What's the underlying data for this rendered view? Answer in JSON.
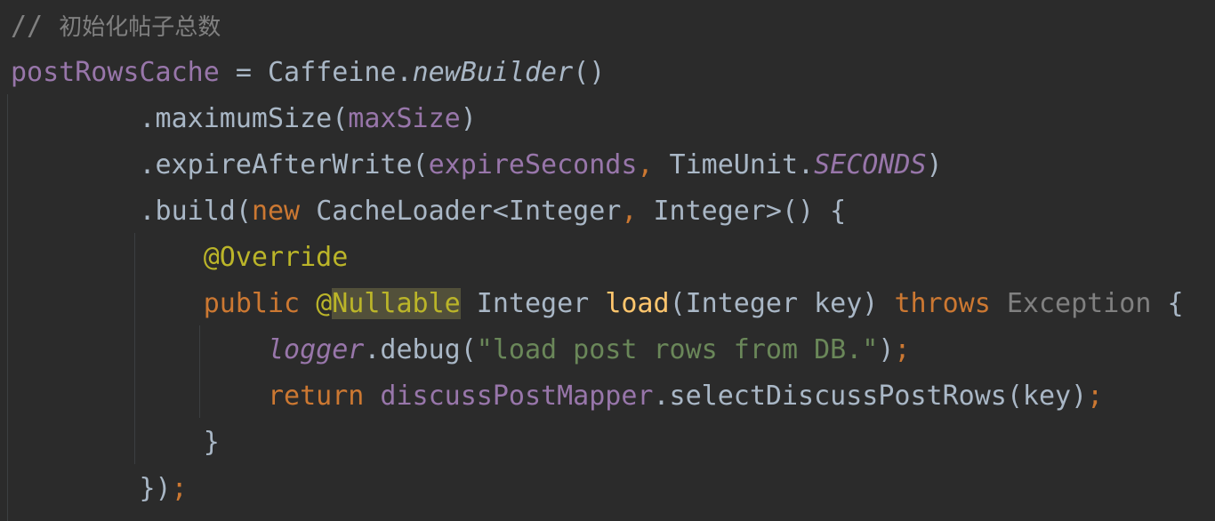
{
  "lines": [
    [
      {
        "t": "// ",
        "c": "t-comment",
        "n": "comment-prefix"
      },
      {
        "t": "初始化帖子总数",
        "c": "t-comment-cn",
        "n": "comment-text"
      }
    ],
    [
      {
        "t": "postRowsCache",
        "c": "t-field",
        "n": "field-postRowsCache"
      },
      {
        "t": " = Caffeine.",
        "c": "t-plain",
        "n": "assign-caffeine"
      },
      {
        "t": "newBuilder",
        "c": "t-method-i",
        "n": "method-newBuilder"
      },
      {
        "t": "()",
        "c": "t-plain",
        "n": "parens"
      }
    ],
    [
      {
        "t": "        .maximumSize(",
        "c": "t-plain",
        "n": "method-maximumSize"
      },
      {
        "t": "maxSize",
        "c": "t-field",
        "n": "field-maxSize"
      },
      {
        "t": ")",
        "c": "t-plain",
        "n": "paren-close"
      }
    ],
    [
      {
        "t": "        .expireAfterWrite(",
        "c": "t-plain",
        "n": "method-expireAfterWrite"
      },
      {
        "t": "expireSeconds",
        "c": "t-field",
        "n": "field-expireSeconds"
      },
      {
        "t": ", ",
        "c": "t-kw",
        "n": "comma"
      },
      {
        "t": "TimeUnit.",
        "c": "t-plain",
        "n": "class-TimeUnit"
      },
      {
        "t": "SECONDS",
        "c": "t-field-i",
        "n": "const-SECONDS"
      },
      {
        "t": ")",
        "c": "t-plain",
        "n": "paren-close"
      }
    ],
    [
      {
        "t": "        .build(",
        "c": "t-plain",
        "n": "method-build"
      },
      {
        "t": "new ",
        "c": "t-kw",
        "n": "keyword-new"
      },
      {
        "t": "CacheLoader<Integer",
        "c": "t-plain",
        "n": "type-CacheLoader"
      },
      {
        "t": ", ",
        "c": "t-kw",
        "n": "comma"
      },
      {
        "t": "Integer>() {",
        "c": "t-plain",
        "n": "type-Integer-brace"
      }
    ],
    [
      {
        "t": "            ",
        "c": "t-plain",
        "n": "indent"
      },
      {
        "t": "@Override",
        "c": "t-anno",
        "n": "annotation-override"
      }
    ],
    [
      {
        "t": "            ",
        "c": "t-plain",
        "n": "indent"
      },
      {
        "t": "public ",
        "c": "t-kw",
        "n": "keyword-public"
      },
      {
        "t": "@",
        "c": "t-anno",
        "n": "annotation-at"
      },
      {
        "t": "Nullable",
        "c": "t-anno t-hl",
        "n": "annotation-nullable"
      },
      {
        "t": " Integer ",
        "c": "t-plain",
        "n": "type-Integer"
      },
      {
        "t": "load",
        "c": "t-decl",
        "n": "method-load"
      },
      {
        "t": "(Integer key) ",
        "c": "t-plain",
        "n": "params"
      },
      {
        "t": "throws ",
        "c": "t-kw",
        "n": "keyword-throws"
      },
      {
        "t": "Exception",
        "c": "t-unused",
        "n": "type-Exception"
      },
      {
        "t": " {",
        "c": "t-plain",
        "n": "brace-open"
      }
    ],
    [
      {
        "t": "                ",
        "c": "t-plain",
        "n": "indent"
      },
      {
        "t": "logger",
        "c": "t-field-i",
        "n": "field-logger"
      },
      {
        "t": ".debug(",
        "c": "t-plain",
        "n": "method-debug"
      },
      {
        "t": "\"load post rows from DB.\"",
        "c": "t-string",
        "n": "string-literal"
      },
      {
        "t": ")",
        "c": "t-plain",
        "n": "paren-close"
      },
      {
        "t": ";",
        "c": "t-kw",
        "n": "semicolon"
      }
    ],
    [
      {
        "t": "                ",
        "c": "t-plain",
        "n": "indent"
      },
      {
        "t": "return ",
        "c": "t-kw",
        "n": "keyword-return"
      },
      {
        "t": "discussPostMapper",
        "c": "t-field",
        "n": "field-discussPostMapper"
      },
      {
        "t": ".selectDiscussPostRows(key)",
        "c": "t-plain",
        "n": "method-selectDiscussPostRows"
      },
      {
        "t": ";",
        "c": "t-kw",
        "n": "semicolon"
      }
    ],
    [
      {
        "t": "            }",
        "c": "t-plain",
        "n": "brace-close"
      }
    ],
    [
      {
        "t": "        })",
        "c": "t-plain",
        "n": "brace-paren-close"
      },
      {
        "t": ";",
        "c": "t-kw",
        "n": "semicolon"
      }
    ]
  ]
}
